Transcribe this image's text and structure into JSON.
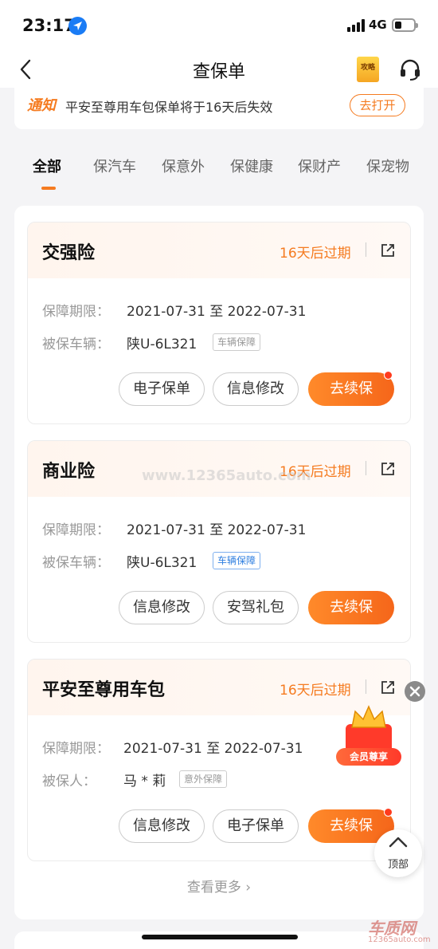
{
  "status_bar": {
    "time": "23:17",
    "network": "4G"
  },
  "nav": {
    "title": "查保单",
    "guide_label": "攻略"
  },
  "notice": {
    "tag": "通知",
    "message": "平安至尊用车包保单将于16天后失效",
    "action": "去打开"
  },
  "tabs": [
    "全部",
    "保汽车",
    "保意外",
    "保健康",
    "保财产",
    "保宠物"
  ],
  "policies": [
    {
      "name": "交强险",
      "expiry": "16天后过期",
      "period_label": "保障期限：",
      "period": "2021-07-31 至 2022-07-31",
      "insured_label": "被保车辆：",
      "insured": "陕U-6L321",
      "badge": "车辆保障",
      "buttons": [
        "电子保单",
        "信息修改",
        "去续保"
      ]
    },
    {
      "name": "商业险",
      "expiry": "16天后过期",
      "period_label": "保障期限：",
      "period": "2021-07-31 至 2022-07-31",
      "insured_label": "被保车辆：",
      "insured": "陕U-6L321",
      "badge": "车辆保障",
      "buttons": [
        "信息修改",
        "安驾礼包",
        "去续保"
      ]
    },
    {
      "name": "平安至尊用车包",
      "expiry": "16天后过期",
      "period_label": "保障期限：",
      "period": "2021-07-31 至 2022-07-31",
      "insured_label": "被保人：",
      "insured": "马 * 莉",
      "badge": "意外保障",
      "buttons": [
        "信息修改",
        "电子保单",
        "去续保"
      ]
    }
  ],
  "more": "查看更多",
  "floats": {
    "vip_label": "会员尊享",
    "top_label": "顶部"
  },
  "watermark": {
    "brand": "车质网",
    "url": "12365auto.com",
    "center": "www.12365auto.com"
  },
  "colors": {
    "accent": "#f57b20",
    "badge_blue": "#2f7fe0"
  }
}
